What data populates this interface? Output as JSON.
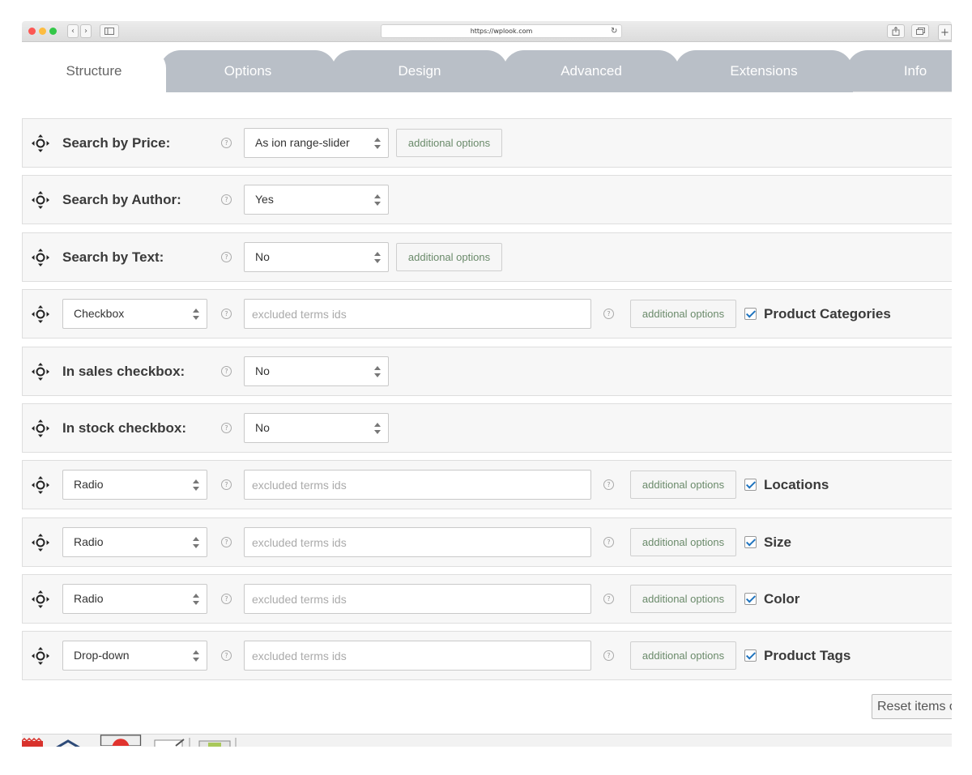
{
  "browser": {
    "url": "https://wplook.com",
    "back_glyph": "‹",
    "forward_glyph": "›",
    "reload_glyph": "↻"
  },
  "tabs": [
    {
      "label": "Structure",
      "active": true
    },
    {
      "label": "Options"
    },
    {
      "label": "Design"
    },
    {
      "label": "Advanced"
    },
    {
      "label": "Extensions"
    },
    {
      "label": "Info"
    }
  ],
  "help_glyph": "?",
  "items": [
    {
      "label": "Search by Price:",
      "select_value": "As ion range-slider",
      "has_options": true
    },
    {
      "label": "Search by Author:",
      "select_value": "Yes",
      "has_options": false
    },
    {
      "label": "Search by Text:",
      "select_value": "No",
      "has_options": true
    },
    {
      "select_value": "Checkbox",
      "input_placeholder": "excluded terms ids",
      "taxonomy": "Product Categories"
    },
    {
      "label": "In sales checkbox:",
      "select_value": "No",
      "has_options": false
    },
    {
      "label": "In stock checkbox:",
      "select_value": "No",
      "has_options": false
    },
    {
      "select_value": "Radio",
      "input_placeholder": "excluded terms ids",
      "taxonomy": "Locations"
    },
    {
      "select_value": "Radio",
      "input_placeholder": "excluded terms ids",
      "taxonomy": "Size"
    },
    {
      "select_value": "Radio",
      "input_placeholder": "excluded terms ids",
      "taxonomy": "Color"
    },
    {
      "select_value": "Drop-down",
      "input_placeholder": "excluded terms ids",
      "taxonomy": "Product Tags"
    }
  ],
  "additional_options_label": "additional options",
  "reset_label": "Reset items order"
}
